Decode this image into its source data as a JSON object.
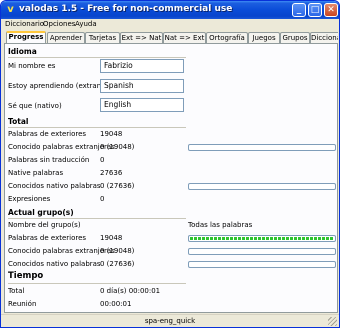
{
  "window": {
    "title": "valodas 1.5  -  Free for non-commercial use",
    "icon": "v"
  },
  "menu": [
    "Diccionario",
    "Opciones",
    "Ayuda"
  ],
  "tabs": [
    {
      "label": "Progress",
      "active": true
    },
    {
      "label": "Aprender",
      "active": false
    },
    {
      "label": "Tarjetas",
      "active": false
    },
    {
      "label": "Ext => Nat",
      "active": false
    },
    {
      "label": "Nat => Ext",
      "active": false
    },
    {
      "label": "Ortografía",
      "active": false
    },
    {
      "label": "Juegos",
      "active": false
    },
    {
      "label": "Grupos",
      "active": false
    },
    {
      "label": "Diccionar",
      "active": false
    }
  ],
  "idioma": {
    "heading": "Idioma",
    "nombre_label": "Mi nombre es",
    "nombre_value": "Fabrizio",
    "aprendiendo_label": "Estoy aprendiendo (extranjero)",
    "aprendiendo_value": "Spanish",
    "nativo_label": "Sé que (nativo)",
    "nativo_value": "English"
  },
  "total": {
    "heading": "Total",
    "rows": [
      {
        "label": "Palabras de exteriores",
        "value": "19048",
        "progress": null
      },
      {
        "label": "Conocido palabras extranjeras",
        "value": "0 (19048)",
        "progress": 0
      },
      {
        "label": "Palabras sin traducción",
        "value": "0",
        "progress": null
      },
      {
        "label": "Native palabras",
        "value": "27636",
        "progress": null
      },
      {
        "label": "Conocidos nativo palabras",
        "value": "0 (27636)",
        "progress": 0
      },
      {
        "label": "Expresiones",
        "value": "0",
        "progress": null
      }
    ]
  },
  "grupo": {
    "heading": "Actual grupo(s)",
    "nombre_label": "Nombre del grupo(s)",
    "nombre_value": "Todas las palabras",
    "rows": [
      {
        "label": "Palabras de exteriores",
        "value": "19048",
        "progress": 1.0
      },
      {
        "label": "Conocido palabras extranjeras",
        "value": "0 (19048)",
        "progress": 0
      },
      {
        "label": "Conocidos nativo palabras",
        "value": "0 (27636)",
        "progress": 0
      }
    ]
  },
  "tiempo": {
    "heading": "Tiempo",
    "rows": [
      {
        "label": "Total",
        "value": "0 día(s) 00:00:01"
      },
      {
        "label": "Reunión",
        "value": "00:00:01"
      }
    ]
  },
  "status": {
    "text": "spa-eng_quick"
  },
  "colors": {
    "progress_fill": "#2fc42f",
    "title_bar": "#0a4cd8",
    "active_tab_accent": "#ffc83c"
  }
}
